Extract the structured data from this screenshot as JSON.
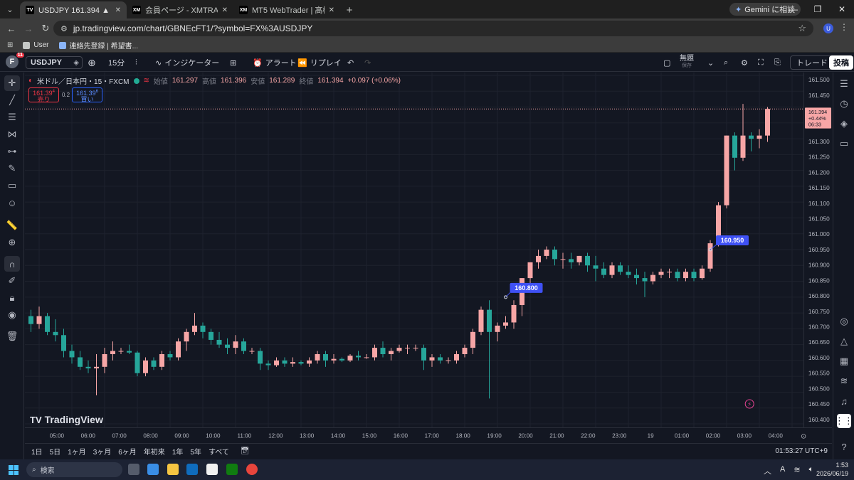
{
  "browser": {
    "tabs": [
      {
        "title": "USDJPY 161.394 ▲ +0.48% 無題",
        "favicon": "TV",
        "active": true
      },
      {
        "title": "会員ページ - XMTRADING",
        "favicon": "XM",
        "active": false
      },
      {
        "title": "MT5 WebTrader | 高機能オンライ",
        "favicon": "XM",
        "active": false
      }
    ],
    "gemini_label": "Gemini に相談",
    "url": "jp.tradingview.com/chart/GBNEcFT1/?symbol=FX%3AUSDJPY",
    "profile_initial": "U",
    "bookmarks": [
      {
        "label": "User"
      },
      {
        "label": "連絡先登録 | 希望書..."
      }
    ]
  },
  "tv_toolbar": {
    "avatar_initial": "F",
    "notif_count": "11",
    "symbol": "USDJPY",
    "interval": "15分",
    "indicators_label": "インジケーター",
    "alert_label": "アラート",
    "replay_label": "リプレイ",
    "layout_title": "無題",
    "layout_status": "保存",
    "trade_label": "トレード",
    "post_label": "投稿"
  },
  "legend": {
    "instrument": "米ドル／日本円・15・FXCM",
    "open_label": "始値",
    "open": "161.297",
    "high_label": "高値",
    "high": "161.396",
    "low_label": "安値",
    "low": "161.289",
    "close_label": "終値",
    "close": "161.394",
    "change": "+0.097 (+0.06%)",
    "sell_price": "161.39",
    "sell_sup": "4",
    "sell_label": "売り",
    "spread": "0.2",
    "buy_price": "161.39",
    "buy_sup": "6",
    "buy_label": "買い"
  },
  "current_price": {
    "price": "161.394",
    "change_pct": "+0.44%",
    "countdown": "06:33"
  },
  "labels_on_chart": [
    {
      "text": "160.950"
    },
    {
      "text": "160.800"
    }
  ],
  "logo_text": "TradingView",
  "range_buttons": [
    "1日",
    "5日",
    "1ヶ月",
    "3ヶ月",
    "6ヶ月",
    "年初来",
    "1年",
    "5年",
    "すべて"
  ],
  "clock": "01:53:27 UTC+9",
  "taskbar": {
    "search_placeholder": "検索",
    "time": "1:53",
    "date": "2026/06/19",
    "ime": "A"
  },
  "colors": {
    "bg": "#131722",
    "up": "#f7a6a6",
    "down": "#26a69a",
    "label": "#3f51f5"
  },
  "chart_data": {
    "type": "candlestick",
    "yaxis_ticks": [
      "161.500",
      "161.450",
      "161.400",
      "161.350",
      "161.300",
      "161.250",
      "161.200",
      "161.150",
      "161.100",
      "161.050",
      "161.000",
      "160.950",
      "160.900",
      "160.850",
      "160.800",
      "160.750",
      "160.700",
      "160.650",
      "160.600",
      "160.550",
      "160.500",
      "160.450",
      "160.400"
    ],
    "ylim": [
      160.4,
      161.5
    ],
    "xaxis_ticks": [
      "05:00",
      "06:00",
      "07:00",
      "08:00",
      "09:00",
      "10:00",
      "11:00",
      "12:00",
      "13:00",
      "14:00",
      "15:00",
      "16:00",
      "17:00",
      "18:00",
      "19:00",
      "20:00",
      "21:00",
      "22:00",
      "23:00",
      "19",
      "01:00",
      "02:00",
      "03:00",
      "04:00"
    ],
    "interval_minutes": 15,
    "first_candle_time": "04:45",
    "candles": [
      [
        160.74,
        160.76,
        160.69,
        160.715
      ],
      [
        160.715,
        160.77,
        160.7,
        160.74
      ],
      [
        160.74,
        160.75,
        160.68,
        160.69
      ],
      [
        160.69,
        160.73,
        160.66,
        160.68
      ],
      [
        160.68,
        160.7,
        160.61,
        160.63
      ],
      [
        160.63,
        160.65,
        160.59,
        160.61
      ],
      [
        160.61,
        160.63,
        160.57,
        160.58
      ],
      [
        160.58,
        160.6,
        160.56,
        160.575
      ],
      [
        160.575,
        160.62,
        160.49,
        160.58
      ],
      [
        160.58,
        160.64,
        160.56,
        160.62
      ],
      [
        160.62,
        160.66,
        160.6,
        160.63
      ],
      [
        160.63,
        160.64,
        160.62,
        160.63
      ],
      [
        160.63,
        160.65,
        160.62,
        160.625
      ],
      [
        160.625,
        160.63,
        160.55,
        160.56
      ],
      [
        160.56,
        160.61,
        160.55,
        160.6
      ],
      [
        160.6,
        160.61,
        160.57,
        160.58
      ],
      [
        160.58,
        160.63,
        160.57,
        160.62
      ],
      [
        160.62,
        160.63,
        160.6,
        160.61
      ],
      [
        160.61,
        160.67,
        160.6,
        160.66
      ],
      [
        160.66,
        160.7,
        160.63,
        160.69
      ],
      [
        160.69,
        160.75,
        160.68,
        160.71
      ],
      [
        160.71,
        160.72,
        160.67,
        160.69
      ],
      [
        160.69,
        160.7,
        160.65,
        160.665
      ],
      [
        160.665,
        160.69,
        160.64,
        160.65
      ],
      [
        160.65,
        160.67,
        160.62,
        160.64
      ],
      [
        160.64,
        160.68,
        160.62,
        160.66
      ],
      [
        160.66,
        160.67,
        160.62,
        160.63
      ],
      [
        160.63,
        160.64,
        160.62,
        160.63
      ],
      [
        160.63,
        160.64,
        160.57,
        160.59
      ],
      [
        160.59,
        160.6,
        160.57,
        160.585
      ],
      [
        160.585,
        160.61,
        160.58,
        160.6
      ],
      [
        160.6,
        160.61,
        160.58,
        160.59
      ],
      [
        160.59,
        160.61,
        160.58,
        160.595
      ],
      [
        160.595,
        160.6,
        160.585,
        160.59
      ],
      [
        160.59,
        160.61,
        160.58,
        160.6
      ],
      [
        160.6,
        160.63,
        160.59,
        160.62
      ],
      [
        160.62,
        160.63,
        160.58,
        160.6
      ],
      [
        160.6,
        160.62,
        160.59,
        160.605
      ],
      [
        160.605,
        160.61,
        160.595,
        160.6
      ],
      [
        160.6,
        160.62,
        160.595,
        160.615
      ],
      [
        160.615,
        160.63,
        160.6,
        160.61
      ],
      [
        160.61,
        160.62,
        160.605,
        160.61
      ],
      [
        160.61,
        160.65,
        160.6,
        160.64
      ],
      [
        160.64,
        160.66,
        160.61,
        160.62
      ],
      [
        160.62,
        160.64,
        160.6,
        160.63
      ],
      [
        160.63,
        160.65,
        160.625,
        160.64
      ],
      [
        160.64,
        160.65,
        160.62,
        160.64
      ],
      [
        160.64,
        160.65,
        160.63,
        160.64
      ],
      [
        160.64,
        160.65,
        160.57,
        160.6
      ],
      [
        160.6,
        160.62,
        160.58,
        160.61
      ],
      [
        160.61,
        160.62,
        160.59,
        160.6
      ],
      [
        160.6,
        160.61,
        160.59,
        160.6
      ],
      [
        160.6,
        160.63,
        160.59,
        160.62
      ],
      [
        160.62,
        160.65,
        160.61,
        160.64
      ],
      [
        160.64,
        160.7,
        160.62,
        160.69
      ],
      [
        160.69,
        160.77,
        160.68,
        160.76
      ],
      [
        160.76,
        160.79,
        160.48,
        160.69
      ],
      [
        160.69,
        160.72,
        160.66,
        160.71
      ],
      [
        160.71,
        160.74,
        160.7,
        160.72
      ],
      [
        160.72,
        160.79,
        160.7,
        160.775
      ],
      [
        160.775,
        160.86,
        160.74,
        160.86
      ],
      [
        160.86,
        160.91,
        160.82,
        160.91
      ],
      [
        160.91,
        160.95,
        160.89,
        160.93
      ],
      [
        160.93,
        160.96,
        160.92,
        160.95
      ],
      [
        160.95,
        160.96,
        160.9,
        160.92
      ],
      [
        160.92,
        160.94,
        160.89,
        160.92
      ],
      [
        160.92,
        160.94,
        160.89,
        160.91
      ],
      [
        160.91,
        160.93,
        160.9,
        160.93
      ],
      [
        160.93,
        160.94,
        160.88,
        160.9
      ],
      [
        160.9,
        160.93,
        160.85,
        160.89
      ],
      [
        160.89,
        160.91,
        160.86,
        160.87
      ],
      [
        160.87,
        160.91,
        160.86,
        160.9
      ],
      [
        160.9,
        160.91,
        160.87,
        160.88
      ],
      [
        160.88,
        160.9,
        160.86,
        160.87
      ],
      [
        160.87,
        160.89,
        160.84,
        160.86
      ],
      [
        160.86,
        160.88,
        160.8,
        160.85
      ],
      [
        160.85,
        160.88,
        160.84,
        160.87
      ],
      [
        160.87,
        160.89,
        160.86,
        160.88
      ],
      [
        160.88,
        160.89,
        160.86,
        160.88
      ],
      [
        160.88,
        160.89,
        160.85,
        160.86
      ],
      [
        160.86,
        160.89,
        160.85,
        160.88
      ],
      [
        160.88,
        160.89,
        160.85,
        160.86
      ],
      [
        160.86,
        160.9,
        160.855,
        160.89
      ],
      [
        160.89,
        160.98,
        160.88,
        160.97
      ],
      [
        160.97,
        161.1,
        160.96,
        161.09
      ],
      [
        161.09,
        161.31,
        161.08,
        161.31
      ],
      [
        161.31,
        161.32,
        161.2,
        161.24
      ],
      [
        161.24,
        161.41,
        161.23,
        161.31
      ],
      [
        161.31,
        161.32,
        161.26,
        161.3
      ],
      [
        161.3,
        161.33,
        161.27,
        161.31
      ],
      [
        161.31,
        161.4,
        161.29,
        161.394
      ]
    ]
  }
}
